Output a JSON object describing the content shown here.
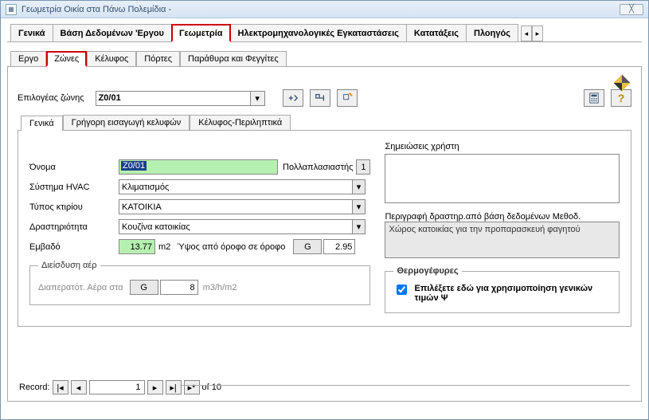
{
  "window": {
    "title": "Γεωμετρία Οικία στα Πάνω Πολεμίδια -"
  },
  "main_tabs": [
    "Γενικά",
    "Βάση Δεδομένων 'Εργου",
    "Γεωμετρία",
    "Ηλεκτρομηχανολογικές Εγκαταστάσεις",
    "Κατατάξεις",
    "Πλοηγός"
  ],
  "main_active": 2,
  "sub_tabs": [
    "Εργο",
    "Ζώνες",
    "Κέλυφος",
    "Πόρτες",
    "Παράθυρα και Φεγγίτες"
  ],
  "sub_active": 1,
  "zone_selector": {
    "label": "Επιλογέας ζώνης",
    "value": "Z0/01"
  },
  "inner_tabs": [
    "Γενικά",
    "Γρήγορη εισαγωγή κελυφών",
    "Κέλυφος-Περιληπτικά"
  ],
  "inner_active": 0,
  "form": {
    "name_label": "Όνομα",
    "name_value": "Z0/01",
    "mult_label": "Πολλαπλασιαστής",
    "mult_value": "1",
    "hvac_label": "Σύστημα HVAC",
    "hvac_value": "Κλιματισμός",
    "btype_label": "Τύπος κτιρίου",
    "btype_value": "ΚΑΤΟΙΚΙΑ",
    "activity_label": "Δραστηριότητα",
    "activity_value": "Κουζίνα κατοικίας",
    "area_label": "Εμβαδό",
    "area_value": "13.77",
    "area_unit": "m2",
    "height_label": "Ύψος από όροφο σε όροφο",
    "height_flag": "G",
    "height_value": "2.95"
  },
  "infiltration": {
    "legend": "Διείσδυση αέρ",
    "label": "Διαπερατότ. Αέρα στα",
    "flag": "G",
    "value": "8",
    "unit": "m3/h/m2"
  },
  "notes": {
    "label": "Σημειώσεις χρήστη",
    "value": ""
  },
  "desc": {
    "label": "Περιγραφή  δραστηρ.από βάση δεδομένων Μεθοδ.",
    "value": "Χώρος κατοικίας για την προπαρασκευή φαγητού"
  },
  "bridges": {
    "legend": "Θερμογέφυρες",
    "check_label": "Επιλέξετε εδώ για χρησιμοποίηση γενικών τιμών Ψ",
    "checked": true
  },
  "record": {
    "label": "Record:",
    "current": "1",
    "of_label": "of",
    "total": "10"
  }
}
